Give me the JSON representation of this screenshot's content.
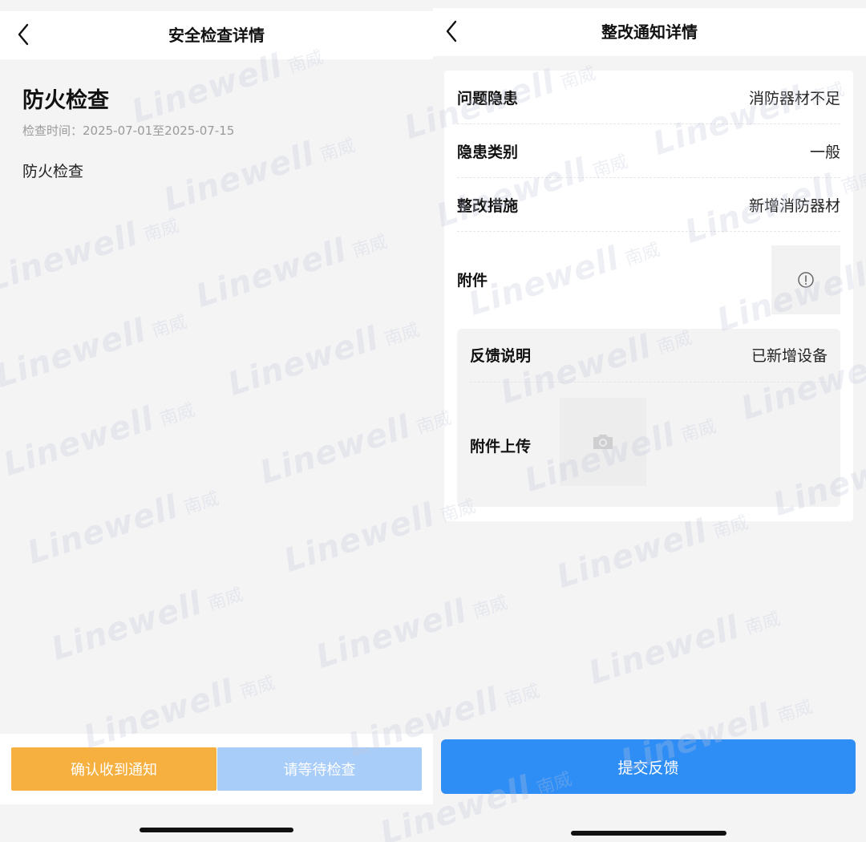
{
  "left_screen": {
    "nav_title": "安全检查详情",
    "inspection_title": "防火检查",
    "inspection_time": "检查时间：2025-07-01至2025-07-15",
    "inspection_desc": "防火检查",
    "confirm_button": "确认收到通知",
    "wait_button": "请等待检查"
  },
  "right_screen": {
    "nav_title": "整改通知详情",
    "rows": [
      {
        "label": "问题隐患",
        "value": "消防器材不足"
      },
      {
        "label": "隐患类别",
        "value": "一般"
      },
      {
        "label": "整改措施",
        "value": "新增消防器材"
      }
    ],
    "attachment_label": "附件",
    "feedback": {
      "label": "反馈说明",
      "value": "已新增设备"
    },
    "upload_label": "附件上传",
    "submit_button": "提交反馈"
  },
  "watermark": {
    "brand": "Linewell",
    "cn": "南威"
  },
  "colors": {
    "confirm": "#f6b040",
    "wait": "#a9cdf9",
    "submit": "#2f8ef5",
    "background": "#f4f4f5"
  }
}
